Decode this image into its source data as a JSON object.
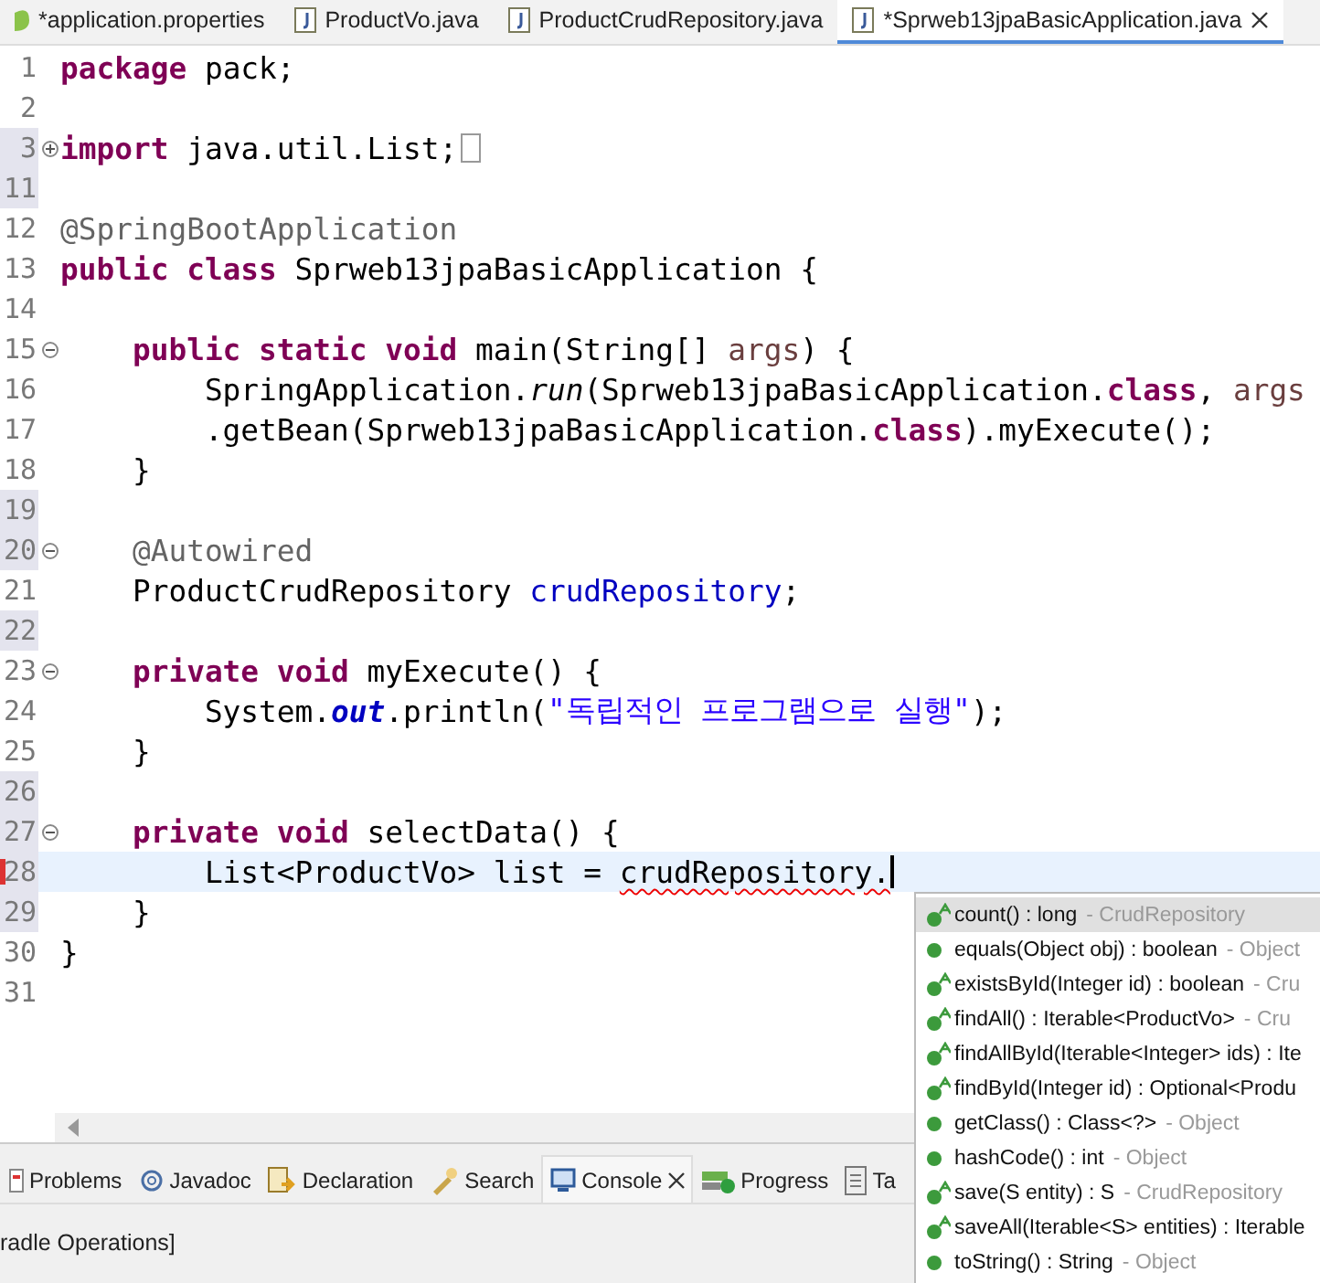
{
  "editor_tabs": [
    {
      "label": "*application.properties",
      "kind": "properties",
      "selected": false
    },
    {
      "label": "ProductVo.java",
      "kind": "java",
      "selected": false
    },
    {
      "label": "ProductCrudRepository.java",
      "kind": "java",
      "selected": false
    },
    {
      "label": "*Sprweb13jpaBasicApplication.java",
      "kind": "java",
      "selected": true,
      "closable": true
    }
  ],
  "code_lines": [
    {
      "number": "1",
      "tokens": [
        {
          "text": "package",
          "kind": "keyword"
        },
        {
          "text": " pack;",
          "kind": "plain"
        }
      ]
    },
    {
      "number": "2"
    },
    {
      "number": "3",
      "expanded": false,
      "marked": true,
      "tokens": [
        {
          "text": "import",
          "kind": "keyword"
        },
        {
          "text": " java.util.List;",
          "kind": "plain"
        }
      ],
      "folded_box": true
    },
    {
      "number": "11",
      "marked": true
    },
    {
      "number": "12",
      "tokens": [
        {
          "text": "@SpringBootApplication",
          "kind": "annotation"
        }
      ]
    },
    {
      "number": "13",
      "tokens": [
        {
          "text": "public class",
          "kind": "keyword"
        },
        {
          "text": " Sprweb13jpaBasicApplication {",
          "kind": "plain"
        }
      ]
    },
    {
      "number": "14"
    },
    {
      "number": "15",
      "expanded": true,
      "tokens": [
        {
          "text": "    public static void",
          "kind": "keyword"
        },
        {
          "text": " main(String[] ",
          "kind": "plain"
        },
        {
          "text": "args",
          "kind": "param"
        },
        {
          "text": ") {",
          "kind": "plain"
        }
      ]
    },
    {
      "number": "16",
      "tokens": [
        {
          "text": "        SpringApplication.",
          "kind": "plain"
        },
        {
          "text": "run",
          "kind": "static"
        },
        {
          "text": "(Sprweb13jpaBasicApplication.",
          "kind": "plain"
        },
        {
          "text": "class",
          "kind": "keyword"
        },
        {
          "text": ", ",
          "kind": "plain"
        },
        {
          "text": "args",
          "kind": "param"
        }
      ]
    },
    {
      "number": "17",
      "tokens": [
        {
          "text": "        .getBean(Sprweb13jpaBasicApplication.",
          "kind": "plain"
        },
        {
          "text": "class",
          "kind": "keyword"
        },
        {
          "text": ").myExecute();",
          "kind": "plain"
        }
      ]
    },
    {
      "number": "18",
      "tokens": [
        {
          "text": "    }",
          "kind": "plain"
        }
      ]
    },
    {
      "number": "19",
      "marked": true
    },
    {
      "number": "20",
      "expanded": true,
      "marked": true,
      "tokens": [
        {
          "text": "    @Autowired",
          "kind": "annotation"
        }
      ]
    },
    {
      "number": "21",
      "tokens": [
        {
          "text": "    ProductCrudRepository ",
          "kind": "plain"
        },
        {
          "text": "crudRepository",
          "kind": "field"
        },
        {
          "text": ";",
          "kind": "plain"
        }
      ]
    },
    {
      "number": "22",
      "marked": true
    },
    {
      "number": "23",
      "expanded": true,
      "tokens": [
        {
          "text": "    private void",
          "kind": "keyword"
        },
        {
          "text": " myExecute() {",
          "kind": "plain"
        }
      ]
    },
    {
      "number": "24",
      "tokens": [
        {
          "text": "        System.",
          "kind": "plain"
        },
        {
          "text": "out",
          "kind": "static_field"
        },
        {
          "text": ".println(",
          "kind": "plain"
        },
        {
          "text": "\"독립적인 프로그램으로 실행\"",
          "kind": "string"
        },
        {
          "text": ");",
          "kind": "plain"
        }
      ]
    },
    {
      "number": "25",
      "tokens": [
        {
          "text": "    }",
          "kind": "plain"
        }
      ]
    },
    {
      "number": "26",
      "marked": true
    },
    {
      "number": "27",
      "expanded": true,
      "marked": true,
      "tokens": [
        {
          "text": "    private void",
          "kind": "keyword"
        },
        {
          "text": " selectData() {",
          "kind": "plain"
        }
      ]
    },
    {
      "number": "28",
      "marked": true,
      "current": true,
      "error": true,
      "tokens": [
        {
          "text": "        List<ProductVo> list = ",
          "kind": "plain"
        },
        {
          "text": "crudRepository.",
          "kind": "error"
        }
      ]
    },
    {
      "number": "29",
      "marked": true,
      "tokens": [
        {
          "text": "    }",
          "kind": "plain"
        }
      ]
    },
    {
      "number": "30",
      "tokens": [
        {
          "text": "}",
          "kind": "plain"
        }
      ]
    },
    {
      "number": "31"
    }
  ],
  "completion_popup": {
    "items": [
      {
        "kind": "override",
        "text": "count() : long",
        "owner": "- CrudRepository",
        "selected": true
      },
      {
        "kind": "method",
        "text": "equals(Object obj) : boolean",
        "owner": "- Object",
        "selected": false
      },
      {
        "kind": "override",
        "text": "existsById(Integer id) : boolean",
        "owner": "- Cru",
        "selected": false
      },
      {
        "kind": "override",
        "text": "findAll() : Iterable<ProductVo>",
        "owner": "- Cru",
        "selected": false
      },
      {
        "kind": "override",
        "text": "findAllById(Iterable<Integer> ids) : Ite",
        "selected": false
      },
      {
        "kind": "override",
        "text": "findById(Integer id) : Optional<Produ",
        "selected": false
      },
      {
        "kind": "method",
        "text": "getClass() : Class<?>",
        "owner": "- Object",
        "selected": false
      },
      {
        "kind": "method",
        "text": "hashCode() : int",
        "owner": "- Object",
        "selected": false
      },
      {
        "kind": "override",
        "text": "save(S entity) : S",
        "owner": "- CrudRepository",
        "selected": false
      },
      {
        "kind": "override",
        "text": "saveAll(Iterable<S> entities) : Iterable",
        "selected": false
      },
      {
        "kind": "method",
        "text": "toString() : String",
        "owner": "- Object",
        "selected": false
      }
    ]
  },
  "bottom_tabs": [
    {
      "label": "Problems",
      "kind": "problems",
      "selected": false
    },
    {
      "label": "Javadoc",
      "kind": "javadoc",
      "selected": false
    },
    {
      "label": "Declaration",
      "kind": "declaration",
      "selected": false
    },
    {
      "label": "Search",
      "kind": "search",
      "selected": false
    },
    {
      "label": "Console",
      "kind": "console",
      "selected": true,
      "closable": true
    },
    {
      "label": "Progress",
      "kind": "progress",
      "selected": false
    },
    {
      "label": "Ta",
      "kind": "tasks",
      "selected": false
    }
  ],
  "console": {
    "text": "radle Operations]"
  }
}
